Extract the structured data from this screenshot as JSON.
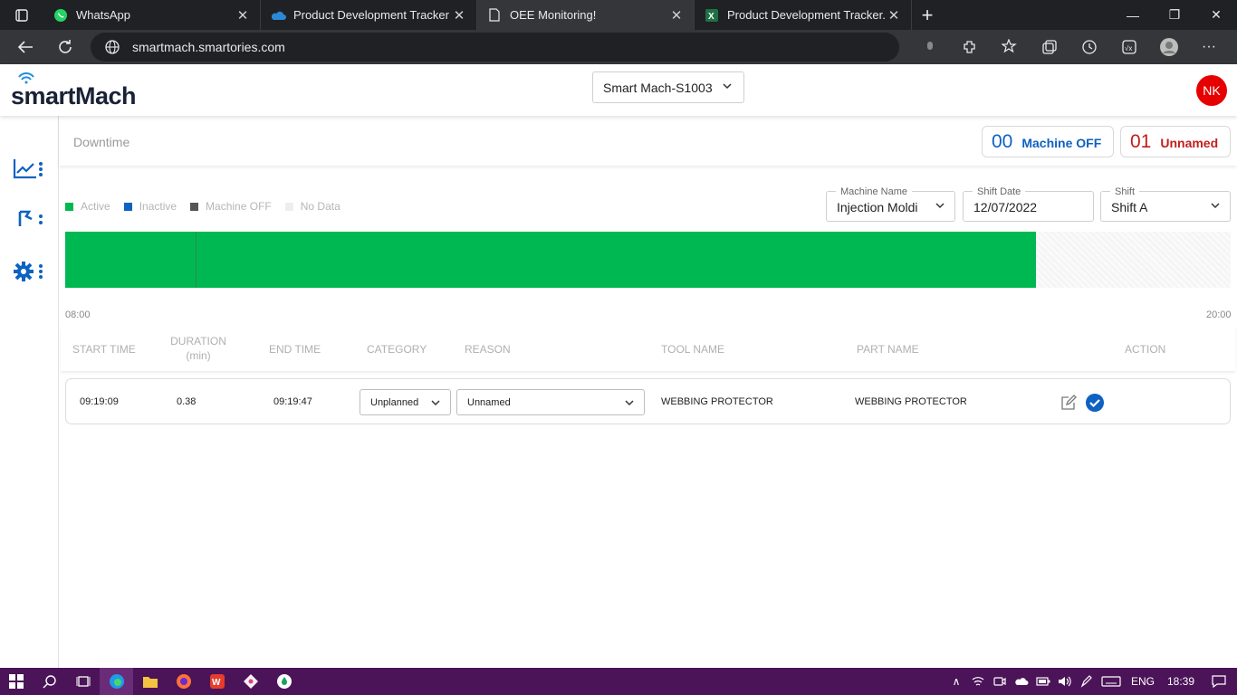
{
  "browser": {
    "tabs": [
      {
        "title": "WhatsApp",
        "icon": "whatsapp-icon",
        "active": false
      },
      {
        "title": "Product Development Tracker - O",
        "icon": "onedrive-icon",
        "active": false
      },
      {
        "title": "OEE Monitoring!",
        "icon": "page-icon",
        "active": true
      },
      {
        "title": "Product Development Tracker.xls",
        "icon": "excel-icon",
        "active": false
      }
    ],
    "url": "smartmach.smartories.com"
  },
  "header": {
    "logo": "smartMach",
    "machine_select": "Smart Mach-S1003",
    "avatar": "NK"
  },
  "page": {
    "title": "Downtime",
    "counters": {
      "machine_off": {
        "count": "00",
        "label": "Machine OFF"
      },
      "unnamed": {
        "count": "01",
        "label": "Unnamed"
      }
    }
  },
  "legend": [
    {
      "label": "Active",
      "color": "#00b851"
    },
    {
      "label": "Inactive",
      "color": "#0d62c2"
    },
    {
      "label": "Machine OFF",
      "color": "#555555"
    },
    {
      "label": "No Data",
      "color": "#eeeeee"
    }
  ],
  "filters": {
    "machine_name": {
      "label": "Machine Name",
      "value": "Injection Moldi"
    },
    "shift_date": {
      "label": "Shift Date",
      "value": "12/07/2022"
    },
    "shift": {
      "label": "Shift",
      "value": "Shift A"
    }
  },
  "timeline": {
    "start_label": "08:00",
    "end_label": "20:00",
    "active_fraction": 0.833,
    "marker_fraction": 0.112
  },
  "table": {
    "headers": {
      "start": "START TIME",
      "duration": "DURATION",
      "duration_unit": "(min)",
      "end": "END TIME",
      "category": "CATEGORY",
      "reason": "REASON",
      "tool": "TOOL NAME",
      "part": "PART NAME",
      "action": "ACTION"
    },
    "rows": [
      {
        "start": "09:19:09",
        "duration": "0.38",
        "end": "09:19:47",
        "category": "Unplanned",
        "reason": "Unnamed",
        "tool": "WEBBING PROTECTOR",
        "part": "WEBBING PROTECTOR"
      }
    ]
  },
  "taskbar": {
    "language": "ENG",
    "time": "18:39"
  }
}
